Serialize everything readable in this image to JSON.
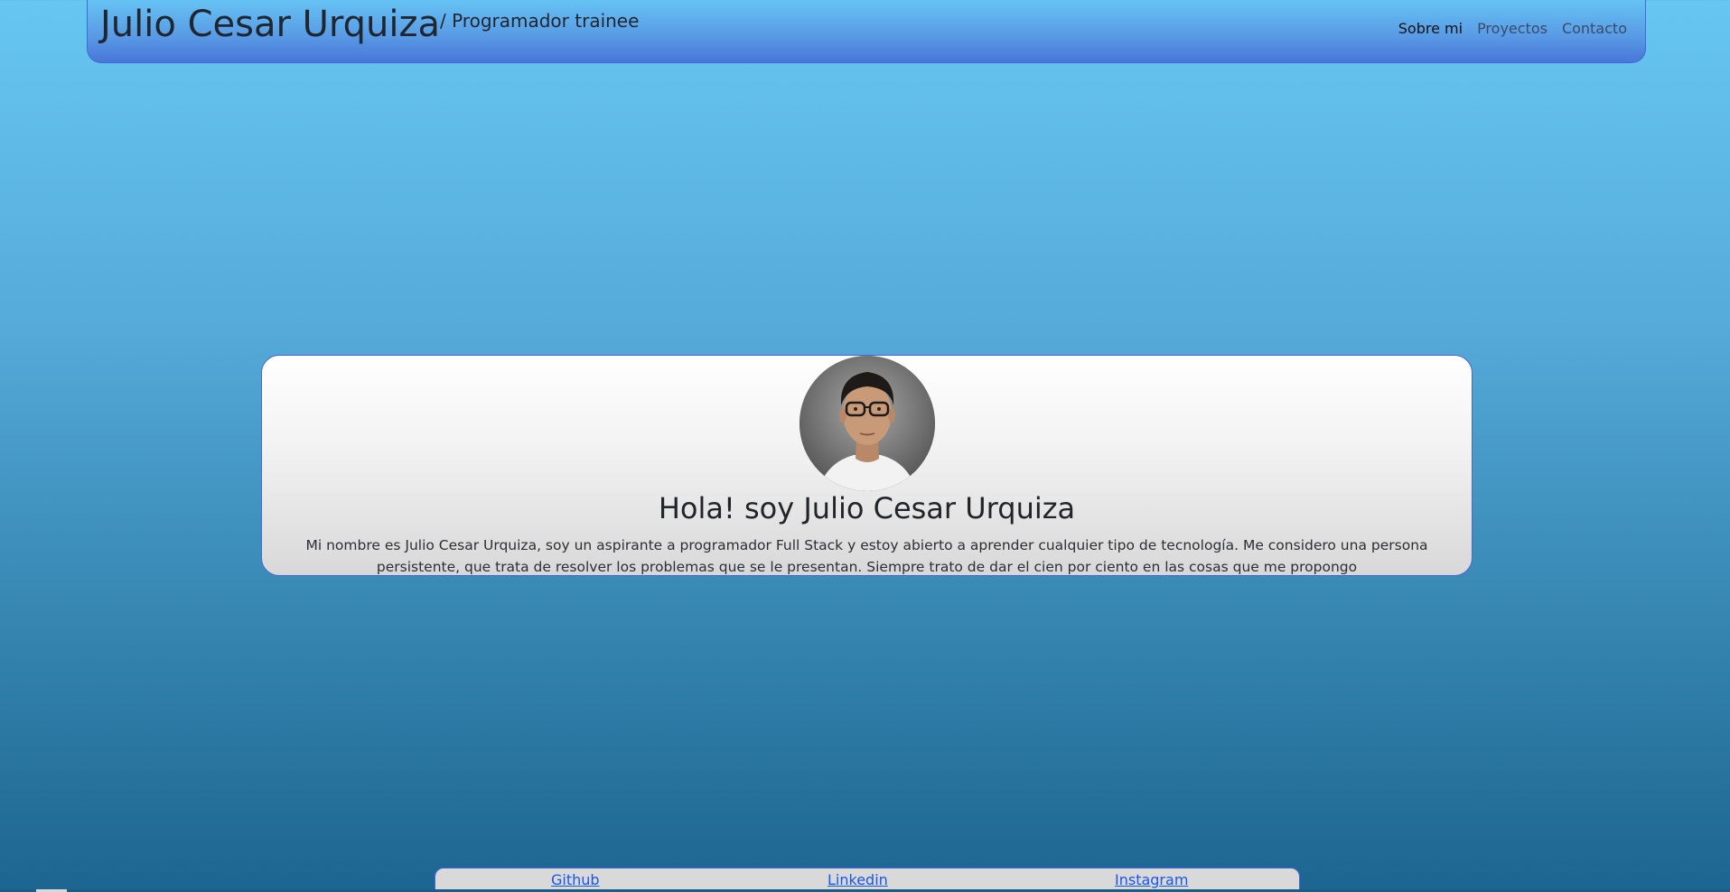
{
  "header": {
    "name": "Julio Cesar Urquiza",
    "role": "/ Programador trainee",
    "nav": [
      {
        "label": "Sobre mi",
        "active": true
      },
      {
        "label": "Proyectos",
        "active": false
      },
      {
        "label": "Contacto",
        "active": false
      }
    ]
  },
  "hero": {
    "title": "Hola! soy Julio Cesar Urquiza",
    "description": "Mi nombre es Julio Cesar Urquiza, soy un aspirante a programador Full Stack y estoy abierto a aprender cualquier tipo de tecnología. Me considero una persona persistente, que trata de resolver los problemas que se le presentan. Siempre trato de dar el cien por ciento en las cosas que me propongo",
    "avatar_icon": "profile-photo"
  },
  "footer": {
    "links": [
      "Github",
      "Linkedin",
      "Instagram"
    ]
  },
  "colors": {
    "accent_border": "#4a66d8",
    "link": "#1a56e8"
  }
}
